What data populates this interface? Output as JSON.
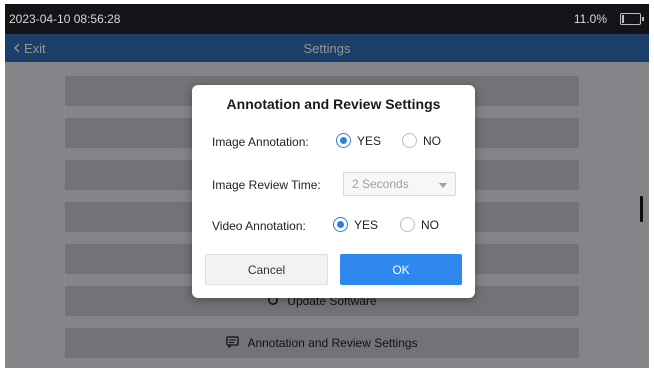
{
  "status_bar": {
    "datetime": "2023-04-10 08:56:28",
    "battery_percent": "11.0%",
    "battery_level": 0.11
  },
  "app_bar": {
    "exit_label": "Exit",
    "title": "Settings"
  },
  "menu": {
    "items": [
      {
        "label": "",
        "icon": ""
      },
      {
        "label": "",
        "icon": ""
      },
      {
        "label": "",
        "icon": ""
      },
      {
        "label": "",
        "icon": ""
      },
      {
        "label": "",
        "icon": ""
      },
      {
        "label": "Update Software",
        "icon": "refresh-icon"
      },
      {
        "label": "Annotation and Review Settings",
        "icon": "message-icon"
      }
    ]
  },
  "dialog": {
    "title": "Annotation and Review Settings",
    "image_annotation": {
      "label": "Image Annotation:",
      "yes": "YES",
      "no": "NO",
      "selected": "YES"
    },
    "image_review_time": {
      "label": "Image Review Time:",
      "value": "2 Seconds"
    },
    "video_annotation": {
      "label": "Video Annotation:",
      "yes": "YES",
      "no": "NO",
      "selected": "YES"
    },
    "cancel_label": "Cancel",
    "ok_label": "OK"
  },
  "colors": {
    "accent": "#2f88ee",
    "app_bar": "#2f6db4",
    "status_bar": "#121417"
  }
}
